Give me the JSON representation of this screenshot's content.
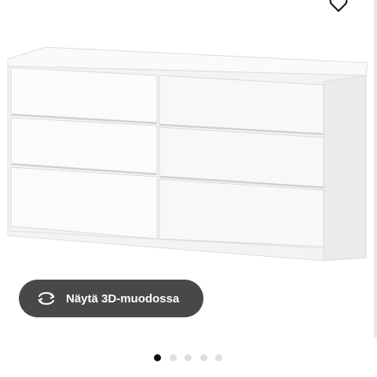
{
  "view_3d": {
    "label": "Näytä 3D-muodossa",
    "icon": "rotate-3d-icon"
  },
  "favorite": {
    "icon": "heart-icon"
  },
  "product_image": {
    "subject": "white six-drawer dresser"
  },
  "carousel": {
    "total": 5,
    "active_index": 0
  },
  "colors": {
    "button_bg": "#484848",
    "dot_active": "#111111",
    "dot_inactive": "#dfdfdf"
  }
}
